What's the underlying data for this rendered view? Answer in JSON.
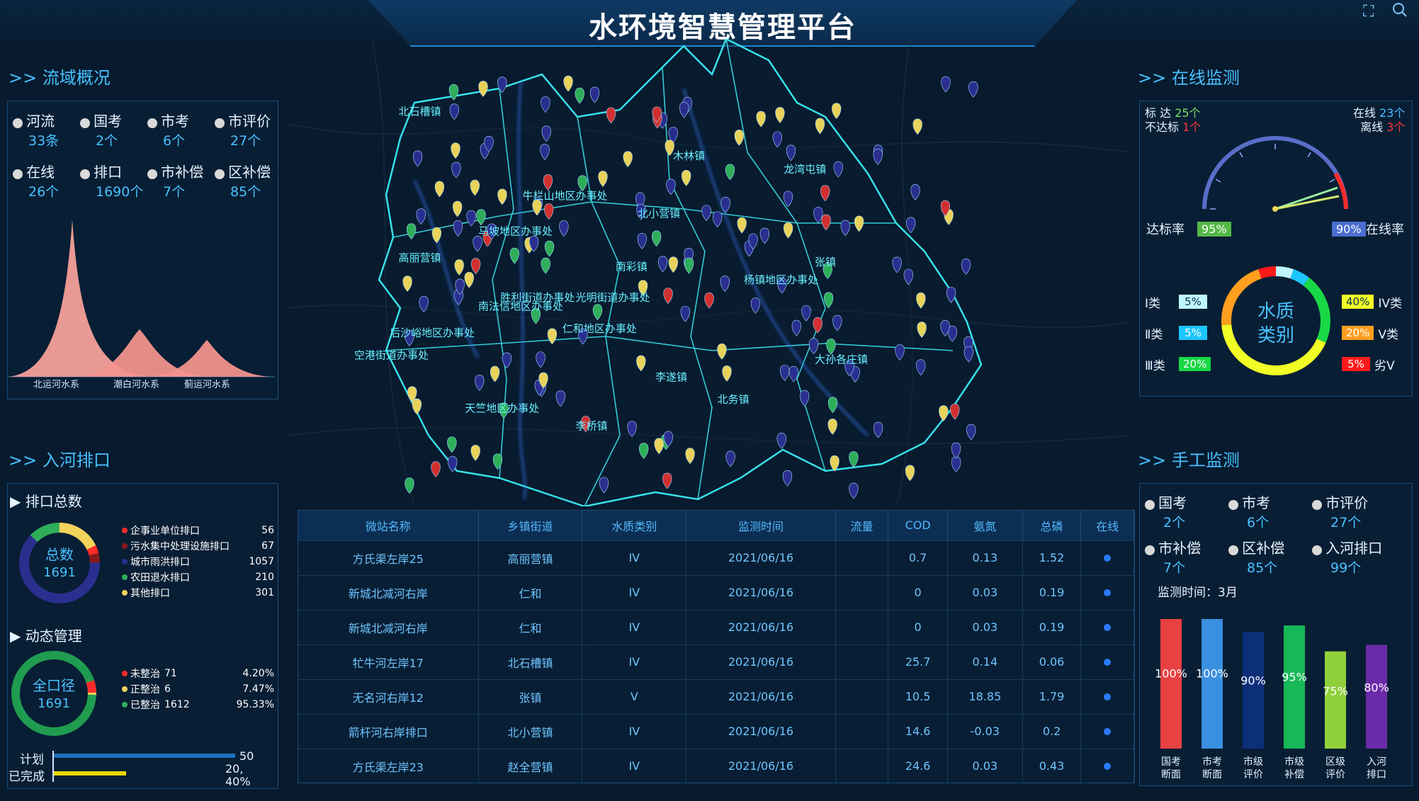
{
  "header": {
    "title": "水环境智慧管理平台",
    "icons": [
      "fullscreen-icon",
      "search-icon"
    ]
  },
  "basin": {
    "title": ">> 流域概况",
    "stats": [
      {
        "label": "河流",
        "value": "33条"
      },
      {
        "label": "国考",
        "value": "2个"
      },
      {
        "label": "市考",
        "value": "6个"
      },
      {
        "label": "市评价",
        "value": "27个"
      },
      {
        "label": "在线",
        "value": "26个"
      },
      {
        "label": "排口",
        "value": "1690个"
      },
      {
        "label": "市补偿",
        "value": "7个"
      },
      {
        "label": "区补偿",
        "value": "85个"
      }
    ],
    "chart_labels": [
      "北运河水系",
      "潮白河水系",
      "蓟运河水系"
    ]
  },
  "outfall": {
    "title": ">> 入河排口",
    "total_title": "▶ 排口总数",
    "donut_label": "总数",
    "donut_value": "1691",
    "legend": [
      {
        "name": "企事业单位排口",
        "value": "56",
        "color": "#ff2b2b"
      },
      {
        "name": "污水集中处理设施排口",
        "value": "67",
        "color": "#8b1a1a"
      },
      {
        "name": "城市雨洪排口",
        "value": "1057",
        "color": "#2a2f8f"
      },
      {
        "name": "农田退水排口",
        "value": "210",
        "color": "#2fae5a"
      },
      {
        "name": "其他排口",
        "value": "301",
        "color": "#f2d35a"
      }
    ],
    "dynamic_title": "▶ 动态管理",
    "donut2_label": "全口径",
    "donut2_value": "1691",
    "dynamic": [
      {
        "name": "未整治",
        "count": "71",
        "pct": "4.20%",
        "color": "#ff2b2b"
      },
      {
        "name": "正整治",
        "count": "6",
        "pct": "7.47%",
        "color": "#f2d35a"
      },
      {
        "name": "已整治",
        "count": "1612",
        "pct": "95.33%",
        "color": "#2fae5a"
      }
    ],
    "plan_label": "计划",
    "plan_value": "50",
    "done_label": "已完成",
    "done_value": "20,",
    "done_pct": "40%",
    "done_ratio": 0.4
  },
  "map": {
    "labels": [
      "北石槽镇",
      "牛栏山地区办事处",
      "木林镇",
      "龙湾屯镇",
      "北小营镇",
      "高丽营镇",
      "马坡地区办事处",
      "南彩镇",
      "杨镇地区办事处",
      "张镇",
      "胜利街道办事处",
      "南法信地区办事处",
      "光明街道办事处",
      "后沙峪地区办事处",
      "仁和地区办事处",
      "大孙各庄镇",
      "李遂镇",
      "北务镇",
      "天竺地区办事处",
      "李桥镇",
      "空港街道办事处"
    ]
  },
  "table": {
    "headers": [
      "微站名称",
      "乡镇街道",
      "水质类别",
      "监测时间",
      "流量",
      "COD",
      "氨氮",
      "总磷",
      "在线"
    ],
    "rows": [
      [
        "方氏渠左岸25",
        "高丽营镇",
        "IV",
        "2021/06/16",
        "",
        "0.7",
        "0.13",
        "1.52"
      ],
      [
        "新城北减河右岸",
        "仁和",
        "IV",
        "2021/06/16",
        "",
        "0",
        "0.03",
        "0.19"
      ],
      [
        "新城北减河右岸",
        "仁和",
        "IV",
        "2021/06/16",
        "",
        "0",
        "0.03",
        "0.19"
      ],
      [
        "牤牛河左岸17",
        "北石槽镇",
        "IV",
        "2021/06/16",
        "",
        "25.7",
        "0.14",
        "0.06"
      ],
      [
        "无名河右岸12",
        "张镇",
        "V",
        "2021/06/16",
        "",
        "10.5",
        "18.85",
        "1.79"
      ],
      [
        "箭杆河右岸排口",
        "北小营镇",
        "IV",
        "2021/06/16",
        "",
        "14.6",
        "-0.03",
        "0.2"
      ],
      [
        "方氏渠左岸23",
        "赵全营镇",
        "IV",
        "2021/06/16",
        "",
        "24.6",
        "0.03",
        "0.43"
      ]
    ]
  },
  "online": {
    "title": ">> 在线监测",
    "standard_label": "标 达",
    "standard_value": "25个",
    "nonstandard_label": "不达标",
    "nonstandard_value": "1个",
    "online_label": "在线",
    "online_value": "23个",
    "offline_label": "离线",
    "offline_value": "3个",
    "rate_label": "达标率",
    "rate_value": "95%",
    "online_rate_label": "在线率",
    "online_rate_value": "90%",
    "quality_center": [
      "水质",
      "类别"
    ],
    "classes_left": [
      {
        "label": "Ⅰ类",
        "value": "5%",
        "color": "#bff7ff"
      },
      {
        "label": "Ⅱ类",
        "value": "5%",
        "color": "#1cc6ff"
      },
      {
        "label": "Ⅲ类",
        "value": "20%",
        "color": "#19d845"
      }
    ],
    "classes_right": [
      {
        "label": "ⅠV类",
        "value": "40%",
        "color": "#f1ff26"
      },
      {
        "label": "V类",
        "value": "20%",
        "color": "#ff9e1f"
      },
      {
        "label": "劣V",
        "value": "5%",
        "color": "#ff1a1a"
      }
    ]
  },
  "manual": {
    "title": ">> 手工监测",
    "stats": [
      {
        "label": "国考",
        "value": "2个"
      },
      {
        "label": "市考",
        "value": "6个"
      },
      {
        "label": "市评价",
        "value": "27个"
      },
      {
        "label": "市补偿",
        "value": "7个"
      },
      {
        "label": "区补偿",
        "value": "85个"
      },
      {
        "label": "入河排口",
        "value": "99个"
      }
    ],
    "month_label": "监测时间：3月"
  },
  "chart_data": {
    "type": "bar",
    "categories": [
      "国考断面",
      "市考断面",
      "市级评价",
      "市级补偿",
      "区级评价",
      "入河排口"
    ],
    "values": [
      100,
      100,
      90,
      95,
      75,
      80
    ],
    "value_labels": [
      "100%",
      "100%",
      "90%",
      "95%",
      "75%",
      "80%"
    ],
    "ylim": [
      0,
      100
    ],
    "colors": [
      "#e84141",
      "#3a8fe0",
      "#0d2f7a",
      "#17b858",
      "#8fcf3a",
      "#6a2aa8"
    ],
    "legend": "none"
  }
}
